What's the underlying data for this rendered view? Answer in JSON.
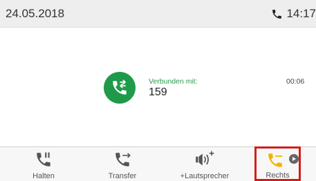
{
  "status": {
    "date": "24.05.2018",
    "time": "14:17"
  },
  "call": {
    "label": "Verbunden mit:",
    "number": "159",
    "duration": "00:06"
  },
  "softkeys": [
    {
      "label": "Halten"
    },
    {
      "label": "Transfer"
    },
    {
      "label": "+Lautsprecher"
    },
    {
      "label": "Rechts"
    }
  ],
  "colors": {
    "call_green": "#1f9a4a",
    "highlight": "#d41c1c",
    "accent_yellow": "#f0b400",
    "icon_gray": "#555555"
  },
  "icons": [
    "phone-icon",
    "call-connected-icon",
    "hold-icon",
    "transfer-icon",
    "speaker-icon",
    "right-line-icon",
    "play-icon"
  ]
}
